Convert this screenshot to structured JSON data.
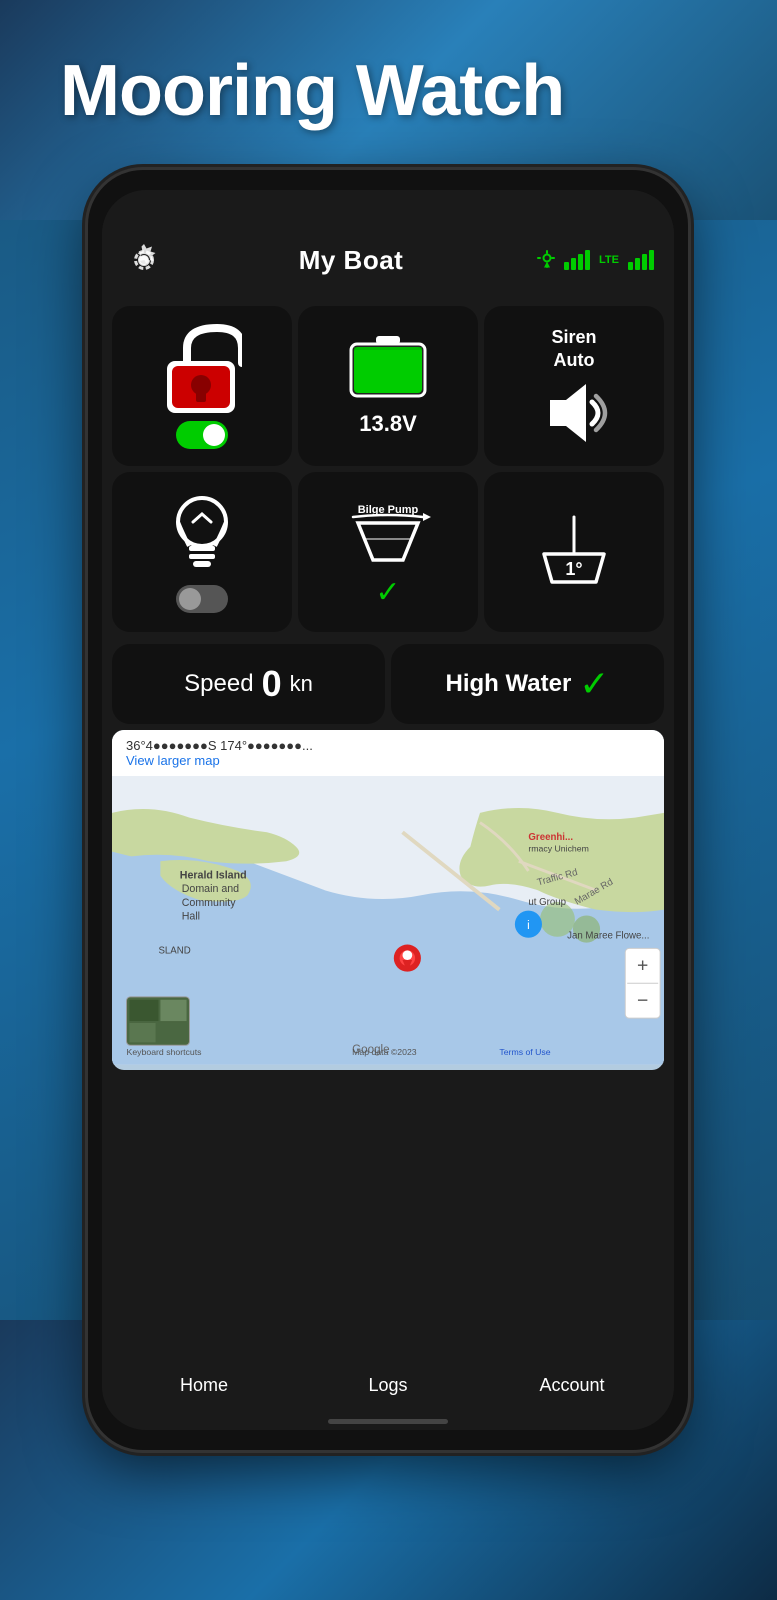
{
  "app": {
    "title": "Mooring Watch"
  },
  "header": {
    "boat_name": "My Boat",
    "lte_label": "LTE"
  },
  "tiles": {
    "lock": {
      "toggle_state": "on"
    },
    "battery": {
      "voltage": "13.8V",
      "fill_percent": 85
    },
    "siren": {
      "line1": "Siren",
      "line2": "Auto"
    },
    "light": {
      "toggle_state": "off"
    },
    "bilge_pump": {
      "label": "Bilge Pump"
    },
    "heel": {
      "degrees": "1°"
    },
    "speed": {
      "label": "Speed",
      "value": "0",
      "unit": "kn"
    },
    "high_water": {
      "label": "High Water"
    }
  },
  "map": {
    "coords": "36°4●●●●●●●S 174°●●●●●●●...",
    "view_larger": "View larger map",
    "attribution": "Google",
    "map_data": "Map data ©2023",
    "terms": "Terms of Use",
    "keyboard": "Keyboard shortcuts"
  },
  "nav": {
    "items": [
      {
        "label": "Home"
      },
      {
        "label": "Logs"
      },
      {
        "label": "Account"
      }
    ]
  }
}
